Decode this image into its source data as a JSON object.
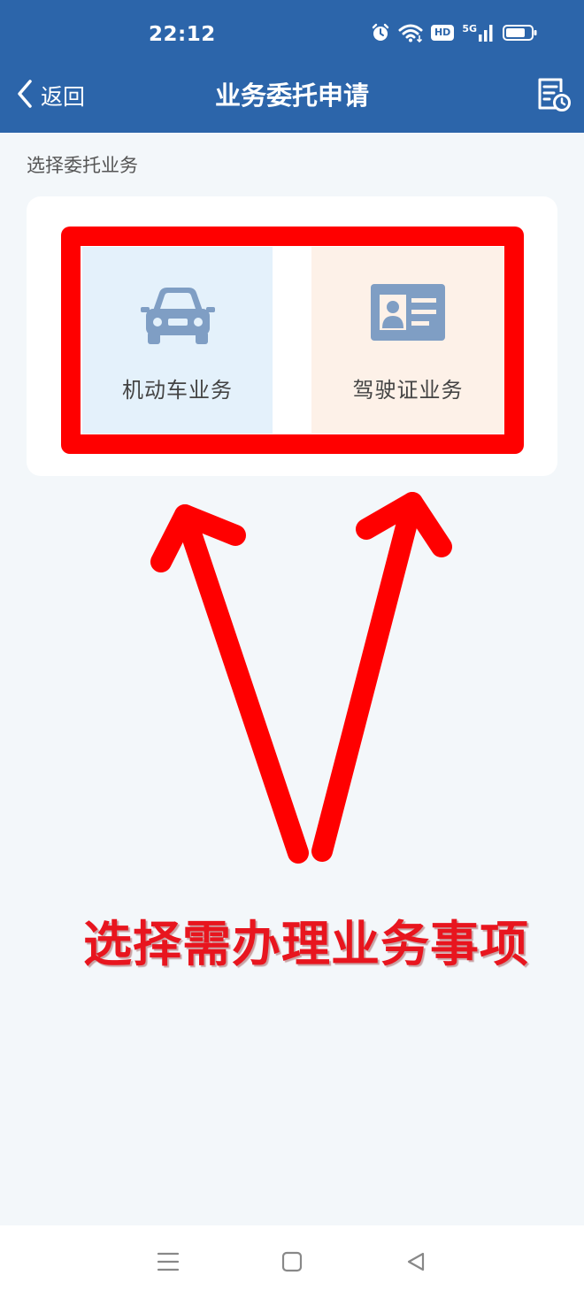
{
  "status_bar": {
    "time": "22:12",
    "icons": [
      "alarm-icon",
      "wifi-icon",
      "hd-badge",
      "5g-signal-icon",
      "battery-icon"
    ],
    "hd_label": "HD",
    "network_label": "5G"
  },
  "nav": {
    "back_label": "返回",
    "title": "业务委托申请",
    "right_icon": "history-record-icon"
  },
  "section_label": "选择委托业务",
  "tiles": [
    {
      "label": "机动车业务",
      "icon": "car-icon",
      "bg": "#e4f1fb"
    },
    {
      "label": "驾驶证业务",
      "icon": "id-card-icon",
      "bg": "#fdf1e8"
    }
  ],
  "annotation": {
    "text": "选择需办理业务事项",
    "color": "#e8151e"
  },
  "system_nav": {
    "icons": [
      "menu-icon",
      "home-icon",
      "back-triangle-icon"
    ]
  },
  "colors": {
    "header_bg": "#2c65aa",
    "page_bg": "#f3f7fa",
    "highlight_red": "#ff0000",
    "icon_blue": "#7f9ec4"
  }
}
